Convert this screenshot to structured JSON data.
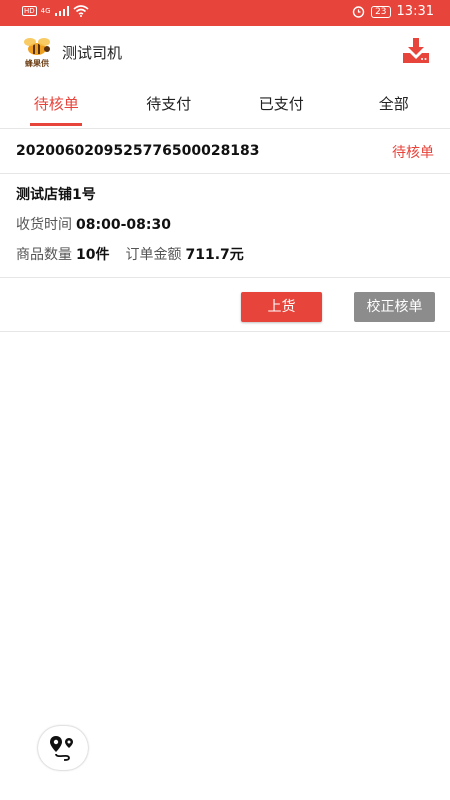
{
  "status_bar": {
    "left_icons": [
      "sim-icon",
      "4g-icon",
      "signal-icon",
      "wifi-icon"
    ],
    "network": "4G",
    "battery": "23",
    "time": "13:31"
  },
  "header": {
    "logo_text": "蜂果供",
    "title": "测试司机",
    "icon": "download-icon"
  },
  "tabs": [
    {
      "label": "待核单",
      "active": true
    },
    {
      "label": "待支付",
      "active": false
    },
    {
      "label": "已支付",
      "active": false
    },
    {
      "label": "全部",
      "active": false
    }
  ],
  "order": {
    "order_no": "202006020952577650002​8183",
    "status": "待核单",
    "store": "测试店铺1号",
    "receive_time_label": "收货时间",
    "receive_time": "08:00-08:30",
    "qty_label": "商品数量",
    "qty": "10件",
    "amount_label": "订单金额",
    "amount": "711.7元",
    "ship_button": "上货",
    "verify_button": "校正核单"
  },
  "fab": {
    "icon": "map-route-icon"
  },
  "colors": {
    "accent": "#e7443b",
    "gray_button": "#8c8c8c"
  }
}
